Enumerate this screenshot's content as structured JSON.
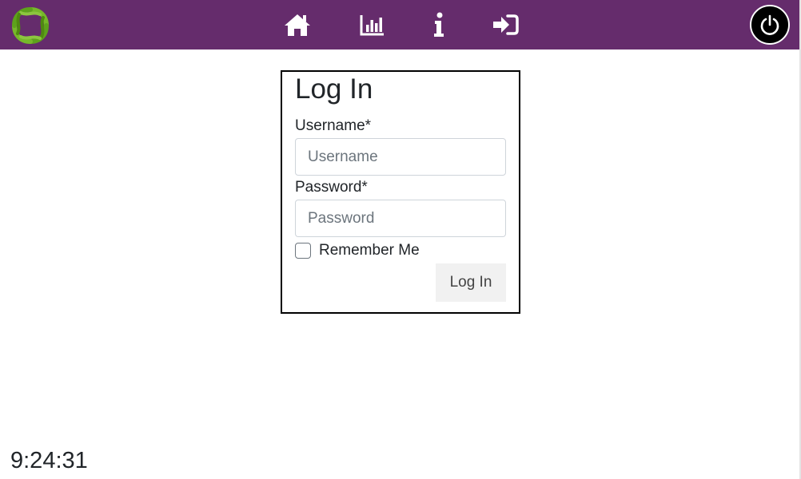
{
  "colors": {
    "navbar_background": "#652c6c",
    "logo_green": "#76b82a",
    "logo_dark_green": "#4f8a10",
    "nav_icon": "#ffffff",
    "power_button": "#000000"
  },
  "navbar": {
    "logo_icon": "green-ring-logo-icon",
    "items": [
      {
        "icon": "home-icon"
      },
      {
        "icon": "bar-chart-icon"
      },
      {
        "icon": "info-icon"
      },
      {
        "icon": "sign-in-icon"
      }
    ],
    "power_icon": "power-icon"
  },
  "login_form": {
    "title": "Log In",
    "username_label": "Username*",
    "username_placeholder": "Username",
    "username_value": "",
    "password_label": "Password*",
    "password_placeholder": "Password",
    "password_value": "",
    "remember_label": "Remember Me",
    "remember_checked": false,
    "submit_label": "Log In"
  },
  "clock": {
    "time": "9:24:31"
  }
}
